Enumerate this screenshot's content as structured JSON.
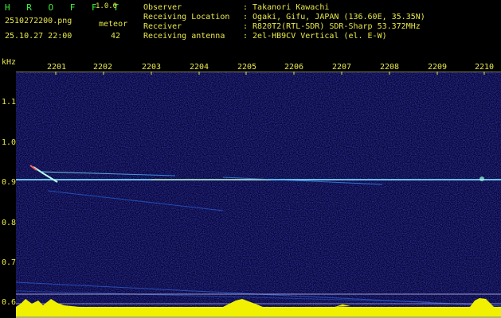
{
  "header": {
    "app_logo": "H R O F F T",
    "version": "1.0.0",
    "filename": "2510272200.png",
    "meteor_label": "meteor",
    "datetime": "25.10.27 22:00",
    "meteor_count": "42"
  },
  "info": [
    {
      "key": "Observer",
      "value": ": Takanori Kawachi"
    },
    {
      "key": "Receiving Location",
      "value": ": Ogaki, Gifu, JAPAN (136.60E, 35.35N)"
    },
    {
      "key": "Receiver",
      "value": ": R820T2(RTL-SDR) SDR-Sharp 53.372MHz"
    },
    {
      "key": "Receiving antenna",
      "value": ": 2el-HB9CV Vertical (el. E-W)"
    }
  ],
  "axis": {
    "y_unit": "kHz",
    "y_ticks": [
      "1.1",
      "1.0",
      "0.9",
      "0.8",
      "0.7",
      "0.6"
    ],
    "x_ticks": [
      "2201",
      "2202",
      "2203",
      "2204",
      "2205",
      "2206",
      "2207",
      "2208",
      "2209",
      "2210"
    ]
  },
  "colors": {
    "background": "#000000",
    "spectrogram_bg": "#06063a",
    "header_text": "#e8e84a",
    "logo": "#3cf23c",
    "activity_bar": "#f0f000"
  }
}
